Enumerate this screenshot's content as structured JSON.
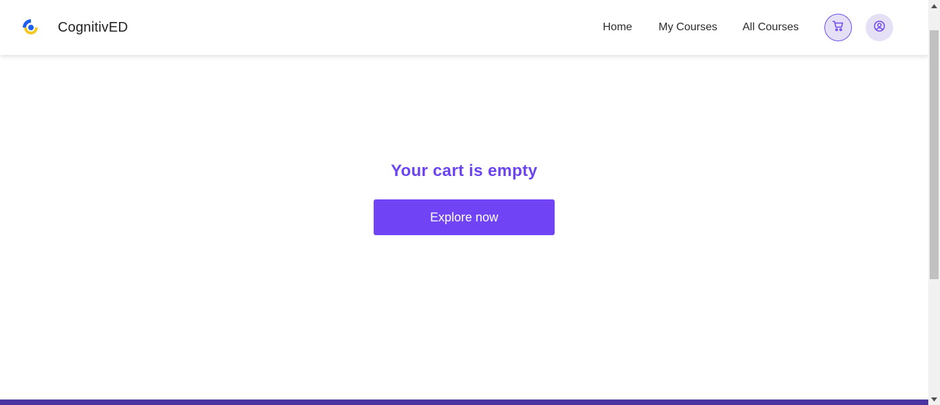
{
  "header": {
    "brand": "CognitivED",
    "nav": {
      "home": "Home",
      "my_courses": "My Courses",
      "all_courses": "All Courses"
    },
    "cart_icon": "cart-icon",
    "profile_icon": "user-circle-icon"
  },
  "main": {
    "empty_message": "Your cart is empty",
    "explore_button": "Explore now"
  },
  "colors": {
    "accent": "#7044f5",
    "accent_text": "#6c44f0",
    "icon_bg": "#e6e0f7",
    "footer": "#4a34a2",
    "logo_blue": "#1e5ff0",
    "logo_yellow": "#f4c81e"
  }
}
